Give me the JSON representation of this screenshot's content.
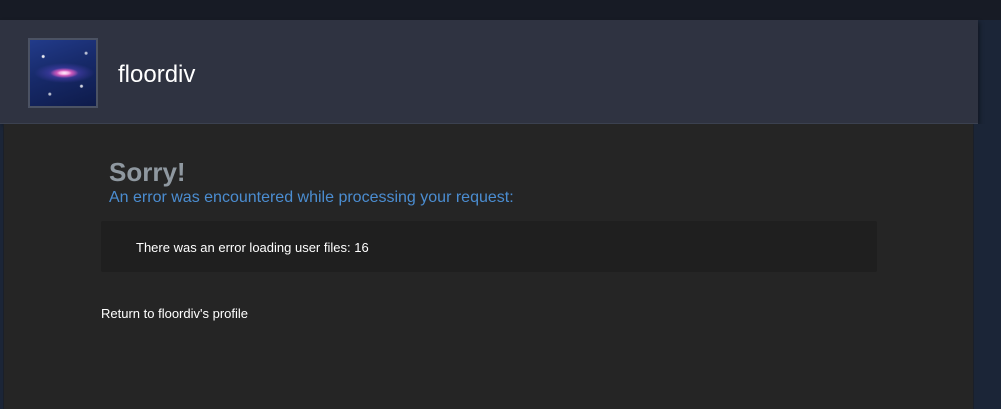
{
  "header": {
    "username": "floordiv",
    "avatar_icon": "galaxy-avatar-icon"
  },
  "error": {
    "title": "Sorry!",
    "subtitle": "An error was encountered while processing your request:",
    "message": "There was an error loading user files: 16"
  },
  "links": {
    "return_profile": "Return to floordiv's profile"
  },
  "colors": {
    "title": "#8f98a0",
    "subtitle": "#4b8dd1",
    "content_bg": "#252525",
    "header_bg": "#2f3341"
  }
}
